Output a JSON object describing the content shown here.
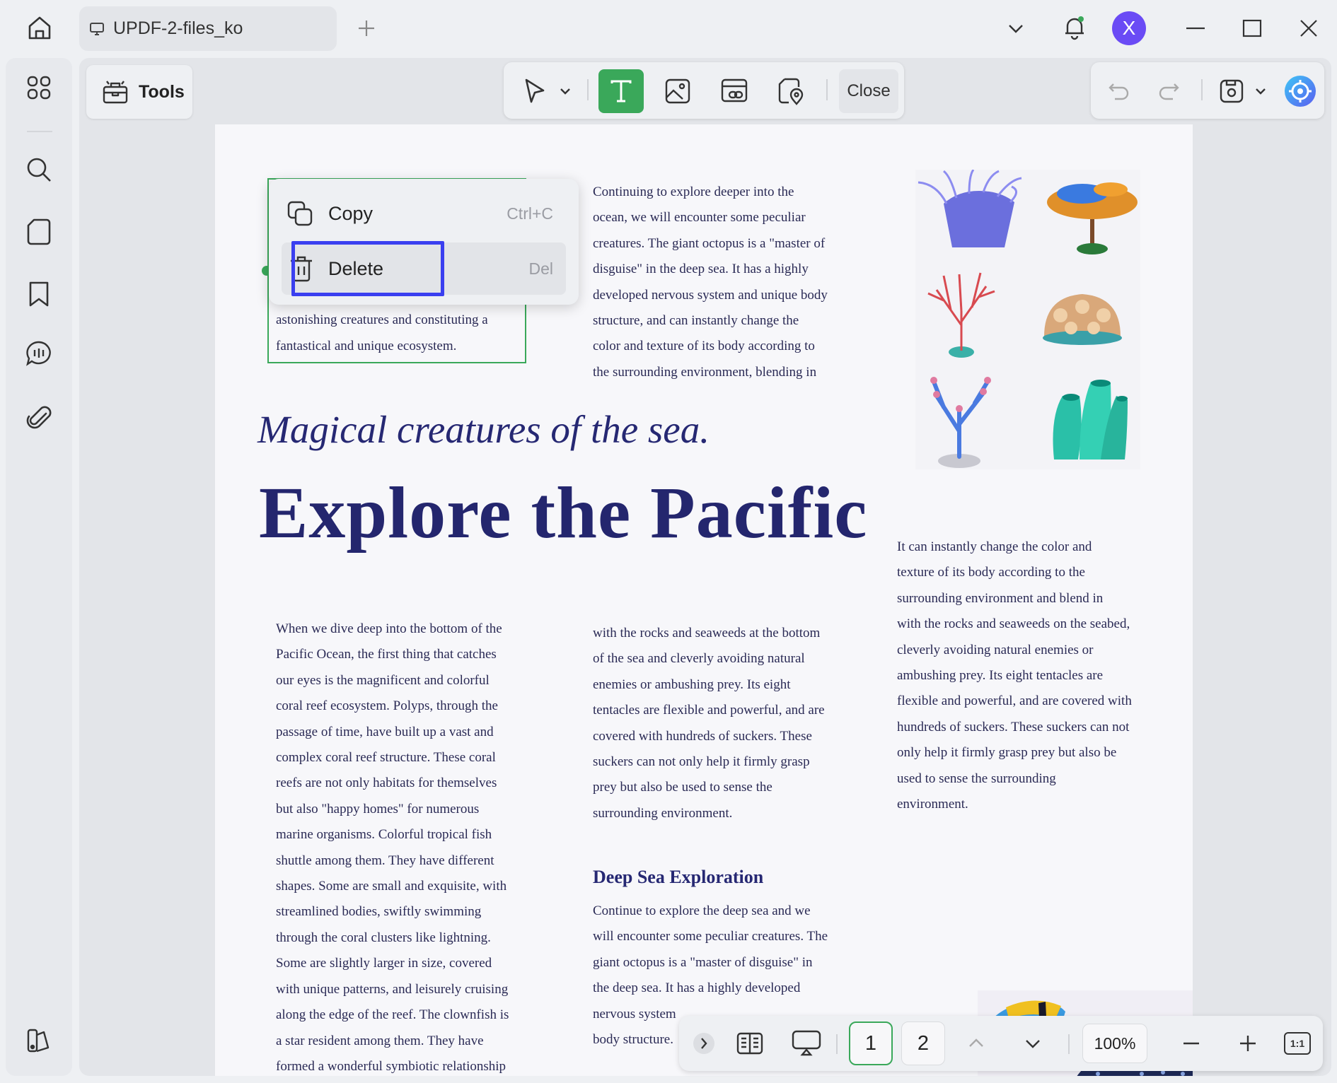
{
  "app": {
    "tab_title": "UPDF-2-files_ko",
    "avatar_letter": "X",
    "accent_color": "#3aa85a",
    "highlight_color": "#3a3ff0"
  },
  "toolbar": {
    "tools_label": "Tools",
    "close_label": "Close"
  },
  "context_menu": {
    "items": [
      {
        "label": "Copy",
        "shortcut": "Ctrl+C"
      },
      {
        "label": "Delete",
        "shortcut": "Del"
      }
    ]
  },
  "document": {
    "selected_text": [
      "astonishing creatures and constituting a",
      "fantastical and unique ecosystem."
    ],
    "col2_top": [
      "Continuing to explore deeper into the",
      "ocean, we will encounter some peculiar",
      "creatures. The giant octopus is a \"master of",
      "disguise\" in the deep sea. It has a highly",
      "developed nervous system and unique body",
      "structure, and can instantly change the",
      "color and texture of its body according to",
      "the surrounding environment, blending in"
    ],
    "subheading": "Magical creatures of the sea.",
    "headline": "Explore the Pacific",
    "col1": [
      "When we dive deep into the bottom of the",
      "Pacific Ocean, the first thing that catches",
      "our eyes is the magnificent and colorful",
      "coral reef ecosystem. Polyps, through the",
      "passage of time, have built up a vast and",
      "complex coral reef structure. These coral",
      "reefs are not only habitats for themselves",
      "but also \"happy homes\" for numerous",
      "marine organisms. Colorful tropical fish",
      "shuttle among them. They have different",
      "shapes. Some are small and exquisite, with",
      "streamlined bodies, swiftly swimming",
      "through the coral clusters like lightning.",
      "Some are slightly larger in size, covered",
      "with unique patterns, and leisurely cruising",
      "along the edge of the reef. The clownfish is",
      "a star resident among them. They have",
      "formed a wonderful symbiotic relationship"
    ],
    "col2_mid": [
      "with the rocks and seaweeds at the bottom",
      "of the sea and cleverly avoiding natural",
      "enemies or ambushing prey. Its eight",
      "tentacles are flexible and powerful, and are",
      "covered with hundreds of suckers. These",
      "suckers can not only help it firmly grasp",
      "prey but also be used to sense the",
      "surrounding environment."
    ],
    "section_title": "Deep Sea Exploration",
    "col2_bottom": [
      "Continue to explore the deep sea and we",
      "will encounter some peculiar creatures. The",
      "giant octopus is a \"master of disguise\" in",
      "the deep sea. It has a highly developed",
      "nervous system",
      "body structure."
    ],
    "col3": [
      "It can instantly change the color and",
      "texture of its body according to the",
      "surrounding environment and blend in",
      "with the rocks and seaweeds on the seabed,",
      "cleverly avoiding natural enemies or",
      "ambushing prey. Its eight tentacles are",
      "flexible and powerful, and are covered with",
      "hundreds of suckers. These suckers can not",
      "only help it firmly grasp prey but also be",
      "used to sense the surrounding",
      "environment."
    ]
  },
  "bottombar": {
    "pages": [
      "1",
      "2"
    ],
    "zoom": "100%",
    "fit_label": "1:1"
  }
}
